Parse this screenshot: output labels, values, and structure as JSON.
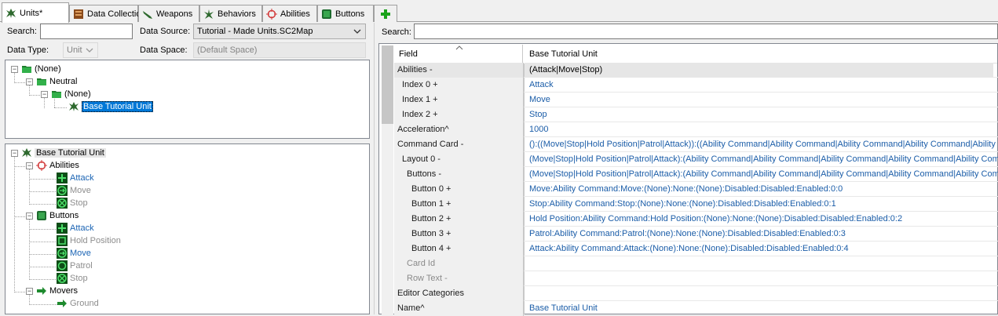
{
  "tabs": [
    {
      "label": "Units*",
      "icon": "unit-icon",
      "active": true
    },
    {
      "label": "Data Collections",
      "icon": "data-collection-icon"
    },
    {
      "label": "Weapons",
      "icon": "weapon-icon"
    },
    {
      "label": "Behaviors",
      "icon": "behavior-icon"
    },
    {
      "label": "Abilities",
      "icon": "ability-icon"
    },
    {
      "label": "Buttons",
      "icon": "button-icon"
    },
    {
      "label": "",
      "icon": "add-tab-icon"
    }
  ],
  "left": {
    "search_label": "Search:",
    "search_value": "",
    "data_source_label": "Data Source:",
    "data_source_value": "Tutorial - Made Units.SC2Map",
    "data_type_label": "Data Type:",
    "data_type_value": "Unit",
    "data_space_label": "Data Space:",
    "data_space_value": "(Default Space)"
  },
  "top_tree": [
    {
      "label": "(None)",
      "icon": "folder-icon"
    },
    {
      "label": "Neutral",
      "icon": "folder-icon"
    },
    {
      "label": "(None)",
      "icon": "folder-icon"
    },
    {
      "label": "Base Tutorial Unit",
      "icon": "unit-icon"
    }
  ],
  "bottom_tree": [
    {
      "label": "Base Tutorial Unit",
      "icon": "unit-icon"
    },
    {
      "label": "Abilities",
      "icon": "ability-icon"
    },
    {
      "label": "Attack",
      "icon": "attack-icon"
    },
    {
      "label": "Move",
      "icon": "move-icon"
    },
    {
      "label": "Stop",
      "icon": "stop-icon"
    },
    {
      "label": "Buttons",
      "icon": "button-icon"
    },
    {
      "label": "Attack",
      "icon": "attack-icon"
    },
    {
      "label": "Hold Position",
      "icon": "hold-icon"
    },
    {
      "label": "Move",
      "icon": "move-icon"
    },
    {
      "label": "Patrol",
      "icon": "patrol-icon"
    },
    {
      "label": "Stop",
      "icon": "stop-icon"
    },
    {
      "label": "Movers",
      "icon": "mover-icon"
    },
    {
      "label": "Ground",
      "icon": "mover-icon"
    }
  ],
  "right": {
    "search_label": "Search:",
    "search_value": "",
    "col_field": "Field",
    "col_value": "Base Tutorial Unit",
    "rows": [
      {
        "field": "Abilities -",
        "value": "(Attack|Move|Stop)"
      },
      {
        "field": "Index 0 +",
        "value": "Attack"
      },
      {
        "field": "Index 1 +",
        "value": "Move"
      },
      {
        "field": "Index 2 +",
        "value": "Stop"
      },
      {
        "field": "Acceleration^",
        "value": "1000"
      },
      {
        "field": "Command Card -",
        "value": "():((Move|Stop|Hold Position|Patrol|Attack)):((Ability Command|Ability Command|Ability Command|Ability Command|Ability Comman"
      },
      {
        "field": "Layout 0 -",
        "value": "(Move|Stop|Hold Position|Patrol|Attack):(Ability Command|Ability Command|Ability Command|Ability Command|Ability Command):("
      },
      {
        "field": "Buttons -",
        "value": "(Move|Stop|Hold Position|Patrol|Attack):(Ability Command|Ability Command|Ability Command|Ability Command|Ability Command):("
      },
      {
        "field": "Button 0 +",
        "value": "Move:Ability Command:Move:(None):None:(None):Disabled:Disabled:Enabled:0:0"
      },
      {
        "field": "Button 1 +",
        "value": "Stop:Ability Command:Stop:(None):None:(None):Disabled:Disabled:Enabled:0:1"
      },
      {
        "field": "Button 2 +",
        "value": "Hold Position:Ability Command:Hold Position:(None):None:(None):Disabled:Disabled:Enabled:0:2"
      },
      {
        "field": "Button 3 +",
        "value": "Patrol:Ability Command:Patrol:(None):None:(None):Disabled:Disabled:Enabled:0:3"
      },
      {
        "field": "Button 4 +",
        "value": "Attack:Ability Command:Attack:(None):None:(None):Disabled:Disabled:Enabled:0:4"
      },
      {
        "field": "Card Id",
        "value": ""
      },
      {
        "field": "Row Text -",
        "value": ""
      },
      {
        "field": "Editor Categories",
        "value": ""
      },
      {
        "field": "Name^",
        "value": "Base Tutorial Unit"
      }
    ]
  }
}
